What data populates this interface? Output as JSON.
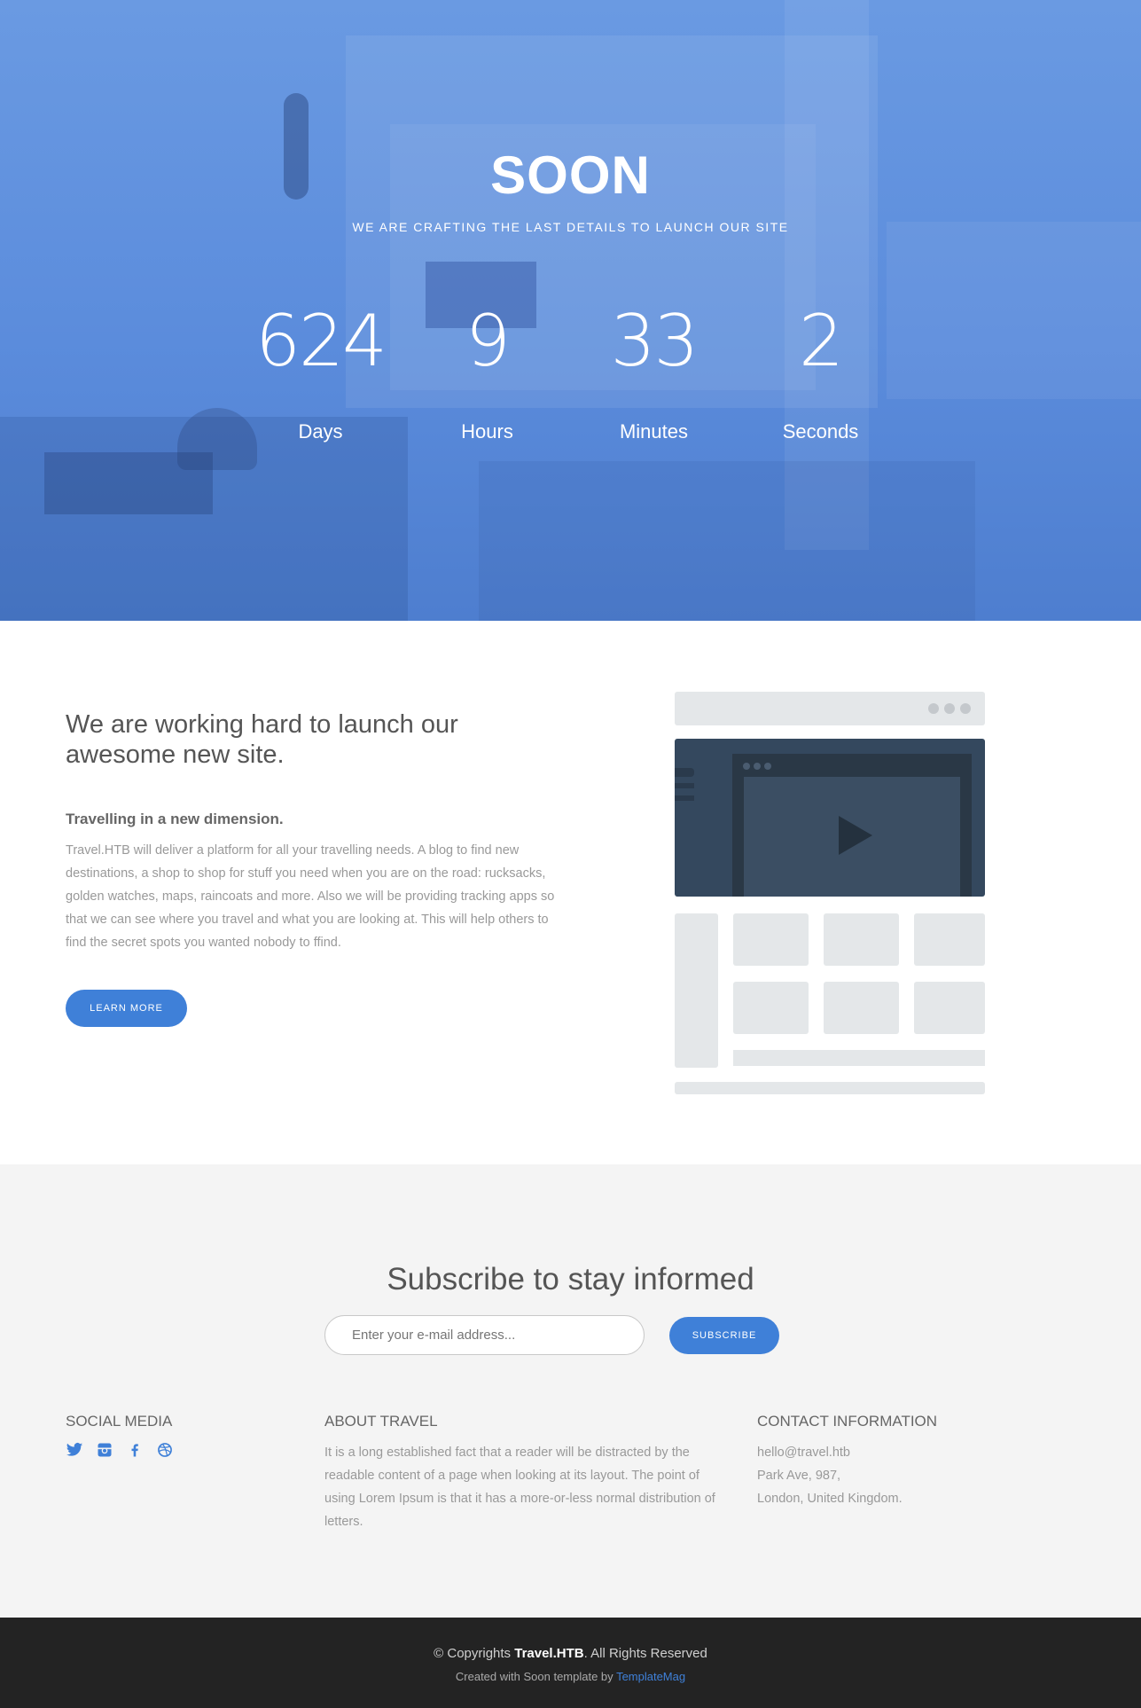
{
  "hero": {
    "title": "SOON",
    "subtitle": "WE ARE CRAFTING THE LAST DETAILS TO LAUNCH OUR SITE",
    "countdown": [
      {
        "value": "624",
        "label": "Days"
      },
      {
        "value": "9",
        "label": "Hours"
      },
      {
        "value": "33",
        "label": "Minutes"
      },
      {
        "value": "2",
        "label": "Seconds"
      }
    ]
  },
  "about": {
    "heading": "We are working hard to launch our awesome new site.",
    "subheading": "Travelling in a new dimension.",
    "body": "Travel.HTB will deliver a platform for all your travelling needs. A blog to find new destinations, a shop to shop for stuff you need when you are on the road: rucksacks, golden watches, maps, raincoats and more. Also we will be providing tracking apps so that we can see where you travel and what you are looking at. This will help others to find the secret spots you wanted nobody to ffind.",
    "button": "LEARN MORE"
  },
  "subscribe": {
    "title": "Subscribe to stay informed",
    "input_placeholder": "Enter your e-mail address...",
    "button": "SUBSCRIBE"
  },
  "footer": {
    "social": {
      "title": "SOCIAL MEDIA",
      "icons": [
        "twitter-icon",
        "instagram-icon",
        "facebook-icon",
        "dribbble-icon"
      ]
    },
    "about": {
      "title": "ABOUT TRAVEL",
      "body": "It is a long established fact that a reader will be distracted by the readable content of a page when looking at its layout. The point of using Lorem Ipsum is that it has a more-or-less normal distribution of letters."
    },
    "contact": {
      "title": "CONTACT INFORMATION",
      "email": "hello@travel.htb",
      "address1": "Park Ave, 987,",
      "address2": "London, United Kingdom."
    }
  },
  "bottom": {
    "copy_prefix": "© Copyrights",
    "brand": "Travel.HTB",
    "copy_suffix": ". All Rights Reserved",
    "created_prefix": "Created with Soon template by",
    "created_link": "TemplateMag"
  },
  "colors": {
    "accent": "#3f80d8",
    "hero": "#5b8cdc",
    "footer_bg": "#232323"
  }
}
